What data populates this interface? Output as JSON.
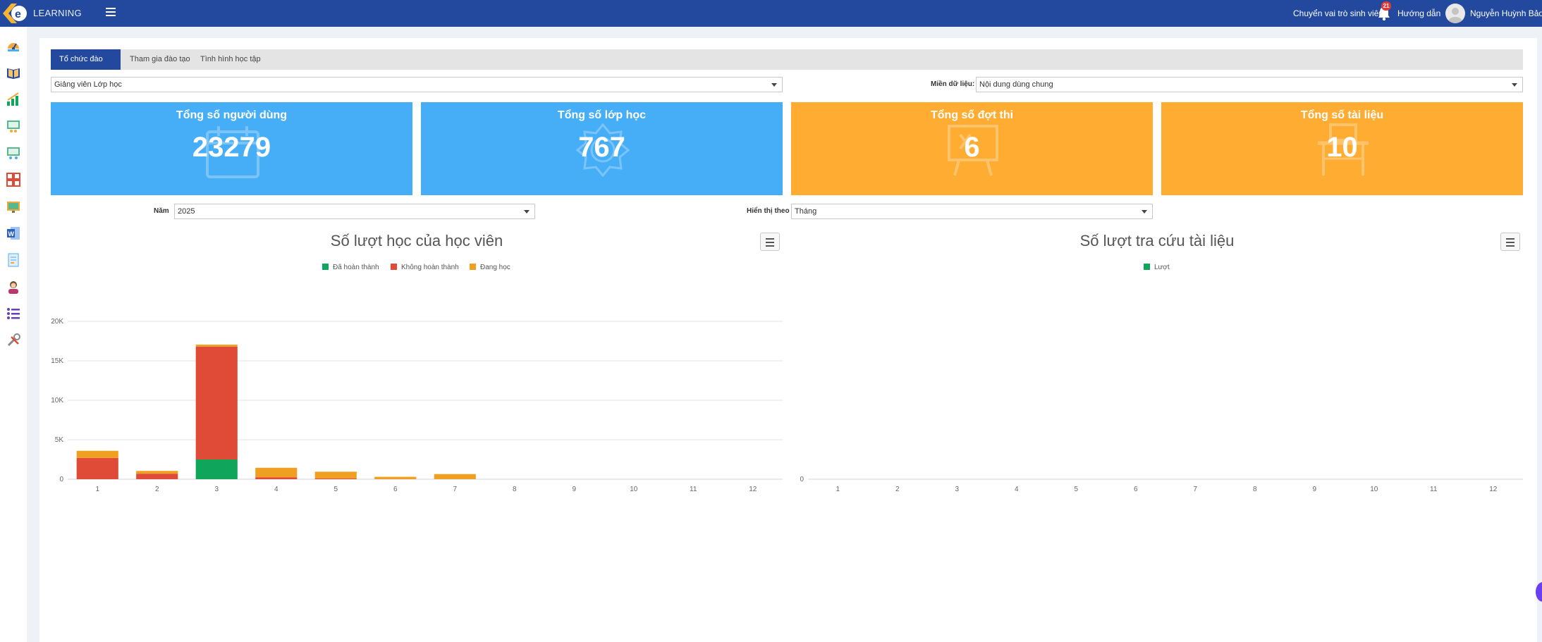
{
  "topbar": {
    "brand": "LEARNING",
    "switch_role": "Chuyển vai trò sinh viên",
    "notification_count": "21",
    "guide": "Hướng dẫn",
    "username": "Nguyễn Huỳnh Bảo Vin"
  },
  "sidebar": {
    "icons": [
      "dashboard-icon",
      "book-icon",
      "growth-chart-icon",
      "classroom-icon",
      "classroom-2-icon",
      "grid-apps-icon",
      "board-icon",
      "word-doc-icon",
      "document-icon",
      "teacher-icon",
      "list-icon",
      "tools-icon"
    ]
  },
  "tabs": [
    {
      "label": "Tổ chức đào tạo",
      "active": true
    },
    {
      "label": "Tham gia đào tạo",
      "active": false
    },
    {
      "label": "Tình hình học tập",
      "active": false
    }
  ],
  "filters": {
    "role_select": "Giảng viên Lớp học",
    "domain_label": "Miền dữ liệu:",
    "domain_select": "Nội dung dùng chung",
    "year_label": "Năm",
    "year_select": "2025",
    "display_label": "Hiển thị theo",
    "display_select": "Tháng"
  },
  "stats": [
    {
      "title": "Tổng số người dùng",
      "value": "23279",
      "color": "#46aef7"
    },
    {
      "title": "Tổng số lớp học",
      "value": "767",
      "color": "#46aef7"
    },
    {
      "title": "Tổng số đợt thi",
      "value": "6",
      "color": "#ffac32"
    },
    {
      "title": "Tổng số tài liệu",
      "value": "10",
      "color": "#ffac32"
    }
  ],
  "colors": {
    "completed": "#0fa55a",
    "not_completed": "#df4b37",
    "in_progress": "#f0a020",
    "lookup": "#0fa55a"
  },
  "chart_data": [
    {
      "type": "bar",
      "stacked": true,
      "title": "Số lượt học của học viên",
      "legend_position": "top-center",
      "categories": [
        "1",
        "2",
        "3",
        "4",
        "5",
        "6",
        "7",
        "8",
        "9",
        "10",
        "11",
        "12"
      ],
      "series": [
        {
          "name": "Đã hoàn thành",
          "color": "#0fa55a",
          "values": [
            0,
            0,
            2500,
            0,
            0,
            0,
            0,
            0,
            0,
            0,
            0,
            0
          ]
        },
        {
          "name": "Không hoàn thành",
          "color": "#df4b37",
          "values": [
            2700,
            700,
            14300,
            250,
            100,
            0,
            0,
            0,
            0,
            0,
            0,
            0
          ]
        },
        {
          "name": "Đang học",
          "color": "#f0a020",
          "values": [
            900,
            350,
            250,
            1200,
            850,
            300,
            650,
            0,
            0,
            0,
            0,
            0
          ]
        }
      ],
      "yticks": [
        "0",
        "5K",
        "10K",
        "15K",
        "20K"
      ],
      "ylim": [
        0,
        20000
      ],
      "grid": true
    },
    {
      "type": "bar",
      "title": "Số lượt tra cứu tài liệu",
      "legend_position": "top-center",
      "categories": [
        "1",
        "2",
        "3",
        "4",
        "5",
        "6",
        "7",
        "8",
        "9",
        "10",
        "11",
        "12"
      ],
      "series": [
        {
          "name": "Lượt",
          "color": "#0fa55a",
          "values": [
            0,
            0,
            0,
            0,
            0,
            0,
            0,
            0,
            0,
            0,
            0,
            0
          ]
        }
      ],
      "yticks": [
        "0"
      ],
      "grid": false
    }
  ]
}
